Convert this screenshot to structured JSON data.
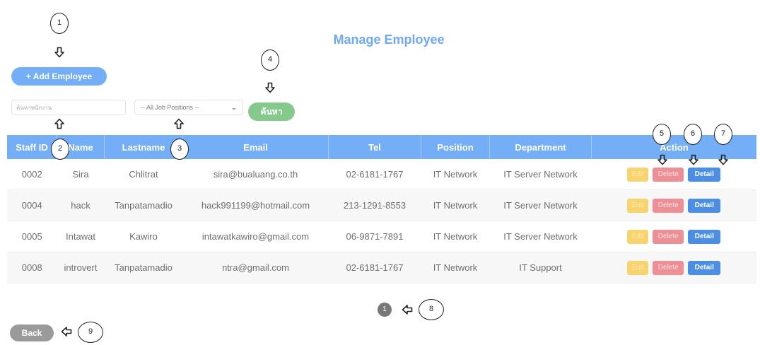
{
  "page": {
    "title": "Manage Employee"
  },
  "toolbar": {
    "add_label": "+ Add Employee",
    "search_placeholder": "ค้นหาพนักงาน",
    "position_filter": "-- All Job Positions --",
    "search_label": "ค้นหา"
  },
  "table": {
    "headers": [
      "Staff ID",
      "Name",
      "Lastname",
      "Email",
      "Tel",
      "Position",
      "Department",
      "Action"
    ],
    "rows": [
      [
        "0002",
        "Sira",
        "Chlitrat",
        "sira@bualuang.co.th",
        "02-6181-1767",
        "IT Network",
        "IT Server Network"
      ],
      [
        "0004",
        "hack",
        "Tanpatamadio",
        "hack991199@hotmail.com",
        "213-1291-8553",
        "IT Network",
        "IT Server Network"
      ],
      [
        "0005",
        "Intawat",
        "Kawiro",
        "intawatkawiro@gmail.com",
        "06-9871-7891",
        "IT Network",
        "IT Server Network"
      ],
      [
        "0008",
        "introvert",
        "Tanpatamadio",
        "ntra@gmail.com",
        "02-6181-1767",
        "IT Network",
        "IT Support"
      ]
    ],
    "actions": {
      "edit": "Edit",
      "delete": "Delete",
      "detail": "Detail"
    }
  },
  "pagination": {
    "current_page": "1"
  },
  "footer": {
    "back_label": "Back"
  },
  "callouts": [
    "1",
    "2",
    "3",
    "4",
    "5",
    "6",
    "7",
    "8",
    "9"
  ],
  "icons": {
    "arrow": "hollow-arrow-icon",
    "select": "chevron-down-icon"
  },
  "colors": {
    "accent": "#73aef7",
    "title": "#6ea8f7",
    "search_button": "#86c98d",
    "edit": "#f9d36c",
    "delete": "#ee8f96",
    "detail": "#4a8ee8",
    "back": "#9a9a9a"
  }
}
